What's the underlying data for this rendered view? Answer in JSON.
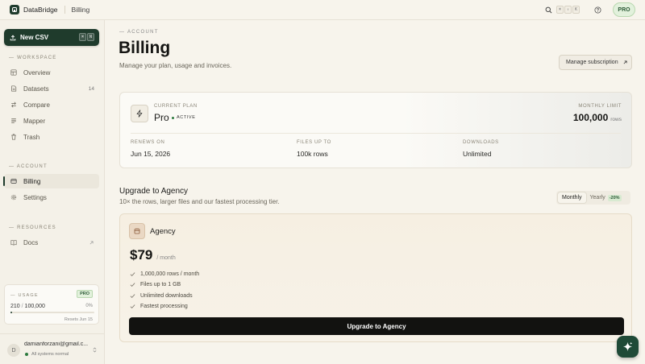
{
  "app": {
    "name": "DataBridge",
    "current_page": "Billing"
  },
  "topbar": {
    "shortcut_keys": [
      "⌘",
      "⇧",
      "K"
    ],
    "plan_badge": "PRO"
  },
  "sidebar": {
    "new_csv": {
      "label": "New CSV",
      "keys": [
        "⌘",
        "N"
      ]
    },
    "sections": {
      "workspace": "WORKSPACE",
      "account": "ACCOUNT",
      "resources": "RESOURCES"
    },
    "workspace_items": [
      {
        "label": "Overview",
        "icon": "grid-icon"
      },
      {
        "label": "Datasets",
        "icon": "file-icon",
        "count": "14"
      },
      {
        "label": "Compare",
        "icon": "swap-icon"
      },
      {
        "label": "Mapper",
        "icon": "list-icon"
      },
      {
        "label": "Trash",
        "icon": "trash-icon"
      }
    ],
    "account_items": [
      {
        "label": "Billing",
        "icon": "card-icon",
        "active": true
      },
      {
        "label": "Settings",
        "icon": "gear-icon"
      }
    ],
    "resource_items": [
      {
        "label": "Docs",
        "icon": "book-icon"
      }
    ],
    "usage": {
      "title": "USAGE",
      "badge": "PRO",
      "used": "210",
      "separator": "/",
      "limit": "100,000",
      "percent": "0%",
      "fill_fraction": 0.0021,
      "reset_text": "Resets Jun 15"
    },
    "user": {
      "initial": "D",
      "email": "damianforzani@gmail.c...",
      "status": "All systems normal"
    }
  },
  "main": {
    "eyebrow": "ACCOUNT",
    "title": "Billing",
    "subtitle": "Manage your plan, usage and invoices.",
    "manage_button": "Manage subscription",
    "plan": {
      "current_label": "CURRENT PLAN",
      "name": "Pro",
      "status": "ACTIVE",
      "limit_label": "MONTHLY LIMIT",
      "limit_value": "100,000",
      "limit_unit": "rows",
      "stats": [
        {
          "label": "RENEWS ON",
          "value": "Jun 15, 2026"
        },
        {
          "label": "FILES UP TO",
          "value": "100k rows"
        },
        {
          "label": "DOWNLOADS",
          "value": "Unlimited"
        }
      ]
    },
    "upgrade": {
      "title": "Upgrade to Agency",
      "subtitle": "10× the rows, larger files and our fastest processing tier.",
      "billing_toggle": {
        "monthly": "Monthly",
        "yearly": "Yearly",
        "discount": "-20%",
        "selected": "monthly"
      },
      "plan_name": "Agency",
      "price": "$79",
      "price_period": "/ month",
      "features": [
        "1,000,000 rows / month",
        "Files up to 1 GB",
        "Unlimited downloads",
        "Fastest processing"
      ],
      "cta": "Upgrade to Agency"
    }
  },
  "colors": {
    "background": "#f7f4ec",
    "brand": "#1f3b2c",
    "accent_green": "#2c7a3e",
    "cta": "#121210"
  }
}
